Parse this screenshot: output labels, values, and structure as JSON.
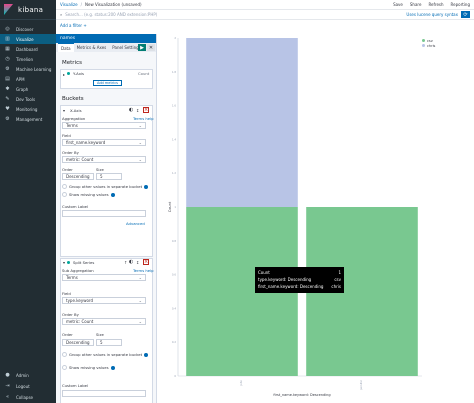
{
  "app": {
    "name": "kibana"
  },
  "nav": {
    "items": [
      {
        "label": "Discover",
        "icon": "compass-icon",
        "glyph": "◎",
        "active": false
      },
      {
        "label": "Visualize",
        "icon": "bar-chart-icon",
        "glyph": "▥",
        "active": true
      },
      {
        "label": "Dashboard",
        "icon": "dashboard-icon",
        "glyph": "▦",
        "active": false
      },
      {
        "label": "Timelion",
        "icon": "timelion-icon",
        "glyph": "◷",
        "active": false
      },
      {
        "label": "Machine Learning",
        "icon": "machine-learning-icon",
        "glyph": "⚙",
        "active": false
      },
      {
        "label": "APM",
        "icon": "apm-icon",
        "glyph": "▤",
        "active": false
      },
      {
        "label": "Graph",
        "icon": "graph-icon",
        "glyph": "✱",
        "active": false
      },
      {
        "label": "Dev Tools",
        "icon": "wrench-icon",
        "glyph": "✎",
        "active": false
      },
      {
        "label": "Monitoring",
        "icon": "heart-icon",
        "glyph": "♥",
        "active": false
      },
      {
        "label": "Management",
        "icon": "gear-icon",
        "glyph": "⚙",
        "active": false
      }
    ],
    "bottom": [
      {
        "label": "Admin",
        "icon": "user-icon",
        "glyph": "●"
      },
      {
        "label": "Logout",
        "icon": "logout-icon",
        "glyph": "⇥"
      },
      {
        "label": "Collapse",
        "icon": "collapse-icon",
        "glyph": "«"
      }
    ]
  },
  "breadcrumb": {
    "root": "Visualize",
    "separator": "/",
    "current": "New Visualization (unsaved)"
  },
  "top_actions": [
    "Save",
    "Share",
    "Refresh",
    "Reporting"
  ],
  "query": {
    "placeholder": "Search... (e.g. status:200 AND extension:PHP)",
    "value": "",
    "lucene_link": "Uses lucene query syntax"
  },
  "filter": {
    "add_label": "Add a filter +"
  },
  "editor": {
    "index_name": "names",
    "tabs": [
      "Data",
      "Metrics & Axes",
      "Panel Settings"
    ],
    "apply_glyph": "▶",
    "discard_glyph": "✕",
    "metrics": {
      "title": "Metrics",
      "item_label": "Y-Axis",
      "item_value": "Count",
      "add_button": "Add metrics"
    },
    "buckets": {
      "title": "Buckets",
      "first": {
        "label": "X-Axis",
        "agg_label": "Aggregation",
        "help_link": "Terms help",
        "agg_value": "Terms",
        "field_label": "Field",
        "field_value": "first_name.keyword",
        "order_by_label": "Order By",
        "order_by_value": "metric: Count",
        "order_label": "Order",
        "order_value": "Descending",
        "size_label": "Size",
        "size_value": "5",
        "group_other": "Group other values in separate bucket",
        "show_missing": "Show missing values",
        "custom_label": "Custom Label",
        "advanced": "Advanced"
      },
      "second": {
        "label": "Split Series",
        "sub_agg_label": "Sub Aggregation",
        "help_link": "Terms help",
        "agg_value": "Terms",
        "field_label": "Field",
        "field_value": "type.keyword",
        "order_by_label": "Order By",
        "order_by_value": "metric: Count",
        "order_label": "Order",
        "order_value": "Descending",
        "size_label": "Size",
        "size_value": "5",
        "group_other": "Group other values in separate bucket",
        "show_missing": "Show missing values",
        "custom_label": "Custom Label"
      }
    }
  },
  "chart_data": {
    "type": "bar",
    "stacked": true,
    "categories": [
      "john",
      "jennifer"
    ],
    "series": [
      {
        "name": "csv",
        "color": "#79c890",
        "values": [
          1,
          1
        ]
      },
      {
        "name": "chris",
        "color": "#b8c4e6",
        "values": [
          1,
          0
        ]
      }
    ],
    "ylim": [
      0,
      2
    ],
    "y_ticks": [
      "0",
      "0.2",
      "0.4",
      "0.6",
      "0.8",
      "1",
      "1.2",
      "1.4",
      "1.6",
      "1.8",
      "2"
    ],
    "ylabel": "Count",
    "xlabel": "first_name.keyword: Descending",
    "legend_position": "top-right"
  },
  "tooltip": {
    "rows": [
      {
        "key": "Count",
        "value": "1"
      },
      {
        "key": "type.keyword: Descending",
        "value": "csv"
      },
      {
        "key": "first_name.keyword: Descending",
        "value": "chris"
      }
    ]
  }
}
